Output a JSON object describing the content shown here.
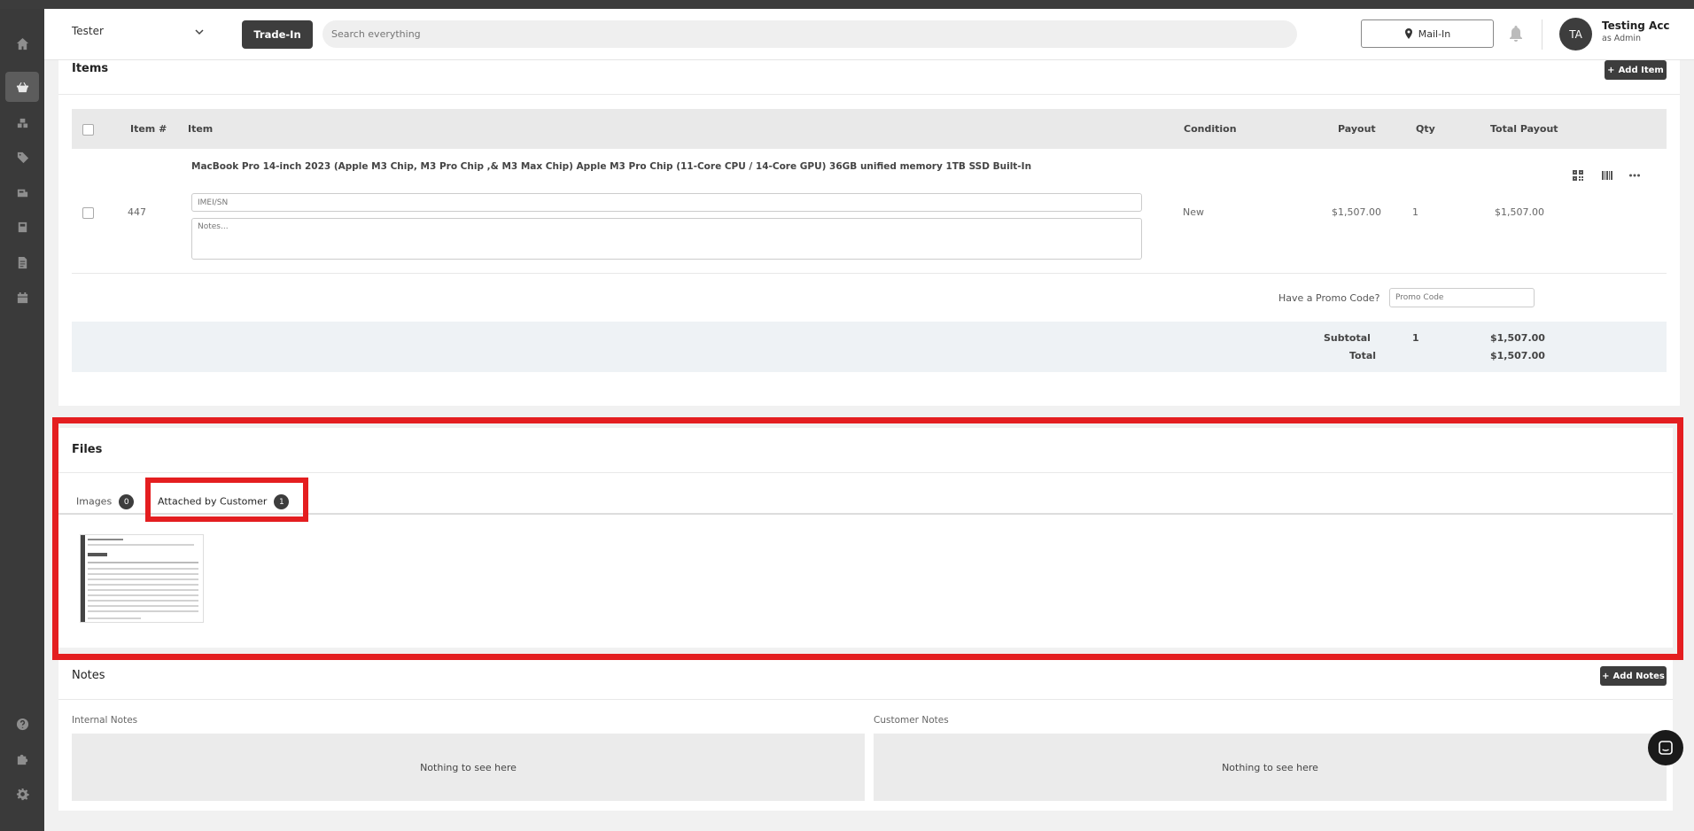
{
  "header": {
    "store_name": "Tester",
    "tradein_label": "Trade-In",
    "search_placeholder": "Search everything",
    "mailin_label": "Mail-In",
    "avatar_initials": "TA",
    "user_name": "Testing Acc",
    "user_role": "as Admin"
  },
  "sidebar": {
    "items": [
      "home-icon",
      "basket-icon",
      "boxes-icon",
      "tag-icon",
      "inventory-icon",
      "storage-icon",
      "document-icon",
      "calendar-icon",
      "help-icon",
      "puzzle-icon",
      "settings-icon"
    ],
    "active": "basket-icon"
  },
  "items_section": {
    "title": "Items",
    "add_label": "Add Item",
    "columns": [
      "Item #",
      "Item",
      "Condition",
      "Payout",
      "Qty",
      "Total Payout"
    ],
    "row": {
      "number": "447",
      "title": "MacBook Pro 14-inch 2023 (Apple M3 Chip, M3 Pro Chip ,& M3 Max Chip) Apple M3 Pro Chip (11-Core CPU / 14-Core GPU) 36GB unified memory 1TB SSD Built-In",
      "imei_placeholder": "IMEI/SN",
      "notes_placeholder": "Notes...",
      "condition": "New",
      "payout": "$1,507.00",
      "qty": "1",
      "total_payout": "$1,507.00"
    },
    "promo_label": "Have a Promo Code?",
    "promo_placeholder": "Promo Code",
    "subtotal_label": "Subtotal",
    "subtotal_qty": "1",
    "subtotal_value": "$1,507.00",
    "total_label": "Total",
    "total_value": "$1,507.00"
  },
  "files_section": {
    "title": "Files",
    "tabs": [
      {
        "label": "Images",
        "count": "0"
      },
      {
        "label": "Attached by Customer",
        "count": "1"
      }
    ],
    "active_tab": "Attached by Customer"
  },
  "notes_section": {
    "title": "Notes",
    "add_label": "Add Notes",
    "internal_label": "Internal Notes",
    "customer_label": "Customer Notes",
    "empty_text": "Nothing to see here"
  },
  "colors": {
    "accent_dark": "#3d3d3d",
    "highlight_red": "#e41e20",
    "sidebar": "#3a3a3a"
  }
}
